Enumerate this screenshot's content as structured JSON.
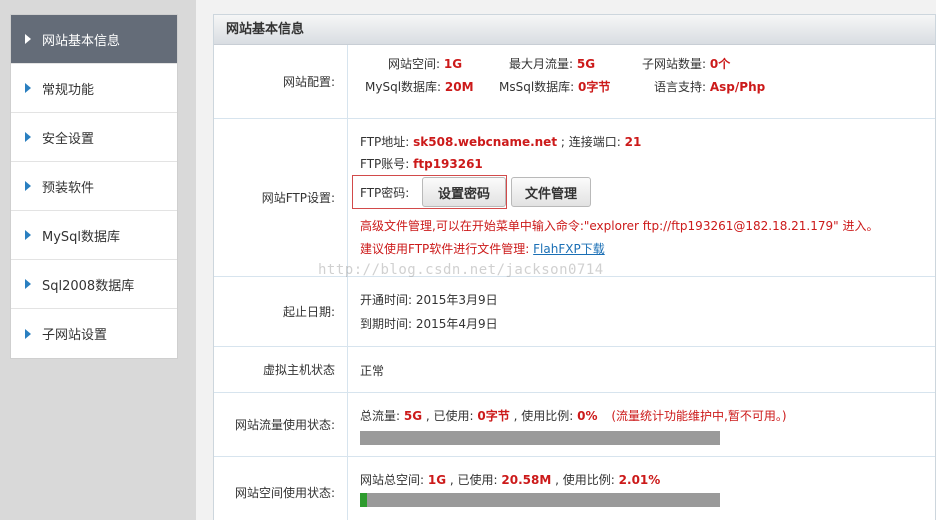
{
  "sidebar": {
    "items": [
      {
        "label": "网站基本信息",
        "active": true
      },
      {
        "label": "常规功能"
      },
      {
        "label": "安全设置"
      },
      {
        "label": "预装软件"
      },
      {
        "label": "MySql数据库"
      },
      {
        "label": "Sql2008数据库"
      },
      {
        "label": "子网站设置"
      }
    ]
  },
  "panel": {
    "title": "网站基本信息",
    "config": {
      "label": "网站配置:",
      "space_label": "网站空间:",
      "space_value": "1G",
      "traffic_label": "最大月流量:",
      "traffic_value": "5G",
      "subsite_label": "子网站数量:",
      "subsite_value": "0个",
      "mysql_label": "MySql数据库:",
      "mysql_value": "20M",
      "mssql_label": "MsSql数据库:",
      "mssql_value": "0字节",
      "lang_label": "语言支持:",
      "lang_value": "Asp/Php"
    },
    "ftp": {
      "label": "网站FTP设置:",
      "addr_label": "FTP地址:",
      "addr_value": "sk508.webcname.net",
      "port_label": "; 连接端口:",
      "port_value": "21",
      "account_label": "FTP账号:",
      "account_value": "ftp193261",
      "pwd_label": "FTP密码:",
      "set_pwd_button": "设置密码",
      "file_mgr_button": "文件管理",
      "advanced_note": "高级文件管理,可以在开始菜单中输入命令:\"explorer ftp://ftp193261@182.18.21.179\" 进入。",
      "suggest_note": "建议使用FTP软件进行文件管理:",
      "fxp_link": "FlahFXP下载"
    },
    "dates": {
      "label": "起止日期:",
      "open_label": "开通时间:",
      "open_value": "2015年3月9日",
      "expire_label": "到期时间:",
      "expire_value": "2015年4月9日"
    },
    "host": {
      "label": "虚拟主机状态",
      "value": "正常"
    },
    "traffic_usage": {
      "label": "网站流量使用状态:",
      "total_label": "总流量:",
      "total_value": "5G",
      "used_label": ", 已使用:",
      "used_value": "0字节",
      "ratio_label": ", 使用比例:",
      "ratio_value": "0%",
      "note": "(流量统计功能维护中,暂不可用。)",
      "progress": 0
    },
    "space_usage": {
      "label": "网站空间使用状态:",
      "total_label": "网站总空间:",
      "total_value": "1G",
      "used_label": ", 已使用:",
      "used_value": "20.58M",
      "ratio_label": ", 使用比例:",
      "ratio_value": "2.01%",
      "progress": 0.0201
    },
    "watermark": "http://blog.csdn.net/jackson0714"
  },
  "colors": {
    "accent_red": "#cc1a1a",
    "sidebar_active": "#646c78",
    "link": "#1a6fb5",
    "progress_fill": "#2e9b2e"
  }
}
